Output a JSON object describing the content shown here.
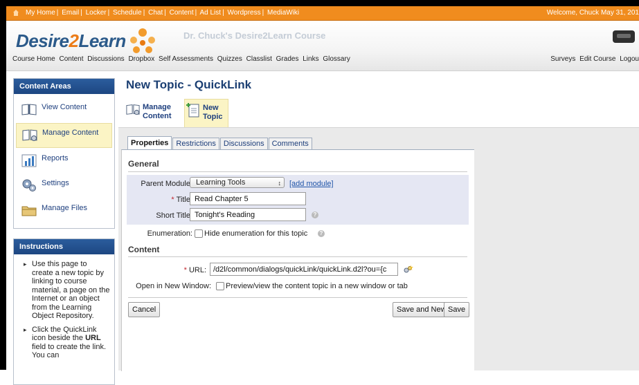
{
  "topbar": {
    "links": [
      "My Home",
      "Email",
      "Locker",
      "Schedule",
      "Chat",
      "Content",
      "Ad List",
      "Wordpress",
      "MediaWiki"
    ],
    "welcome": "Welcome, Chuck  May 31, 201"
  },
  "header": {
    "logo_part1": "Desire",
    "logo_part2": "2",
    "logo_part3": "Learn",
    "course_title": "Dr. Chuck's Desire2Learn Course",
    "course_nav": [
      "Course Home",
      "Content",
      "Discussions",
      "Dropbox",
      "Self Assessments",
      "Quizzes",
      "Classlist",
      "Grades",
      "Links",
      "Glossary"
    ],
    "right_nav": [
      "Surveys",
      "Edit Course",
      "Logou"
    ]
  },
  "sidebar": {
    "content_areas_title": "Content Areas",
    "items": [
      {
        "label": "View Content",
        "icon": "open-book-icon"
      },
      {
        "label": "Manage Content",
        "icon": "manage-book-icon"
      },
      {
        "label": "Reports",
        "icon": "bar-chart-icon"
      },
      {
        "label": "Settings",
        "icon": "gears-icon"
      },
      {
        "label": "Manage Files",
        "icon": "folder-icon"
      }
    ],
    "instructions_title": "Instructions",
    "instructions": [
      {
        "text": "Use this page to create a new topic by linking to course material, a page on the Internet or an object from the Learning Object Repository."
      },
      {
        "pre": "Click the QuickLink icon beside the ",
        "bold": "URL",
        "post": " field to create the link. You can"
      }
    ]
  },
  "main": {
    "page_title": "New Topic - QuickLink",
    "actions": {
      "manage_content": {
        "line1": "Manage",
        "line2": "Content"
      },
      "new_topic": {
        "line1": "New",
        "line2": "Topic"
      }
    },
    "tabs": [
      "Properties",
      "Restrictions",
      "Discussions",
      "Comments"
    ]
  },
  "form": {
    "general_title": "General",
    "parent_module_label": "Parent Module:",
    "parent_module_value": "Learning Tools",
    "add_module_link": "[add module]",
    "title_label": "Title:",
    "title_value": "Read Chapter 5",
    "short_title_label": "Short Title:",
    "short_title_value": "Tonight's Reading",
    "enumeration_label": "Enumeration:",
    "enumeration_checkbox_label": "Hide enumeration for this topic",
    "content_title": "Content",
    "url_label": "URL:",
    "url_value": "/d2l/common/dialogs/quickLink/quickLink.d2l?ou={c",
    "new_window_label": "Open in New Window:",
    "new_window_checkbox_label": "Preview/view the content topic in a new window or tab",
    "required_marker": "*",
    "cancel_label": "Cancel",
    "save_and_new_label": "Save and New",
    "save_label": "Save"
  }
}
